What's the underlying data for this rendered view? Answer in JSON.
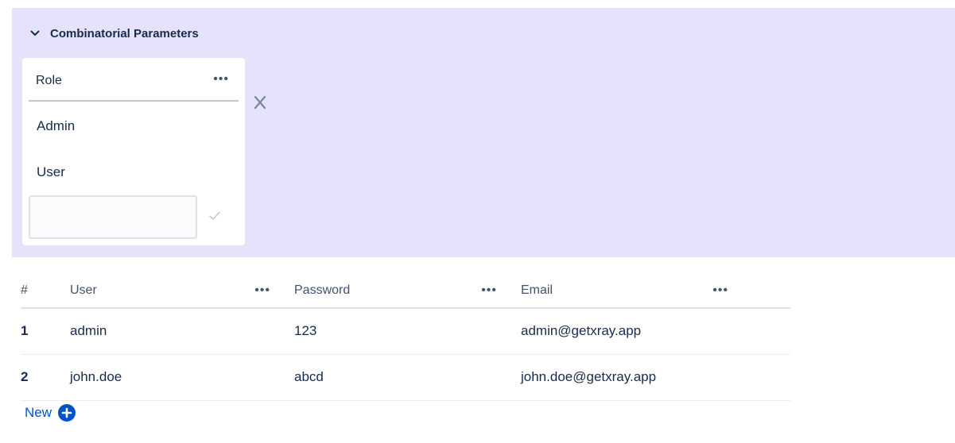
{
  "combinatorial": {
    "title": "Combinatorial Parameters",
    "parameter": {
      "name": "Role",
      "more": "•••",
      "values": [
        "Admin",
        "User"
      ],
      "new_value_input": "",
      "remove_label": "X"
    }
  },
  "table": {
    "columns": [
      {
        "label": "#"
      },
      {
        "label": "User",
        "more": "•••"
      },
      {
        "label": "Password",
        "more": "•••"
      },
      {
        "label": "Email",
        "more": "•••"
      }
    ],
    "rows": [
      {
        "num": "1",
        "user": "admin",
        "password": "123",
        "email": "admin@getxray.app"
      },
      {
        "num": "2",
        "user": "john.doe",
        "password": "abcd",
        "email": "john.doe@getxray.app"
      }
    ]
  },
  "new_button": {
    "label": "New"
  },
  "colors": {
    "panel_bg": "#e6e2fc",
    "link": "#0052cc",
    "text": "#172b4d"
  },
  "icons": {
    "collapse": "chevron-down-icon",
    "confirm": "check-icon",
    "add": "plus-circle-icon"
  }
}
